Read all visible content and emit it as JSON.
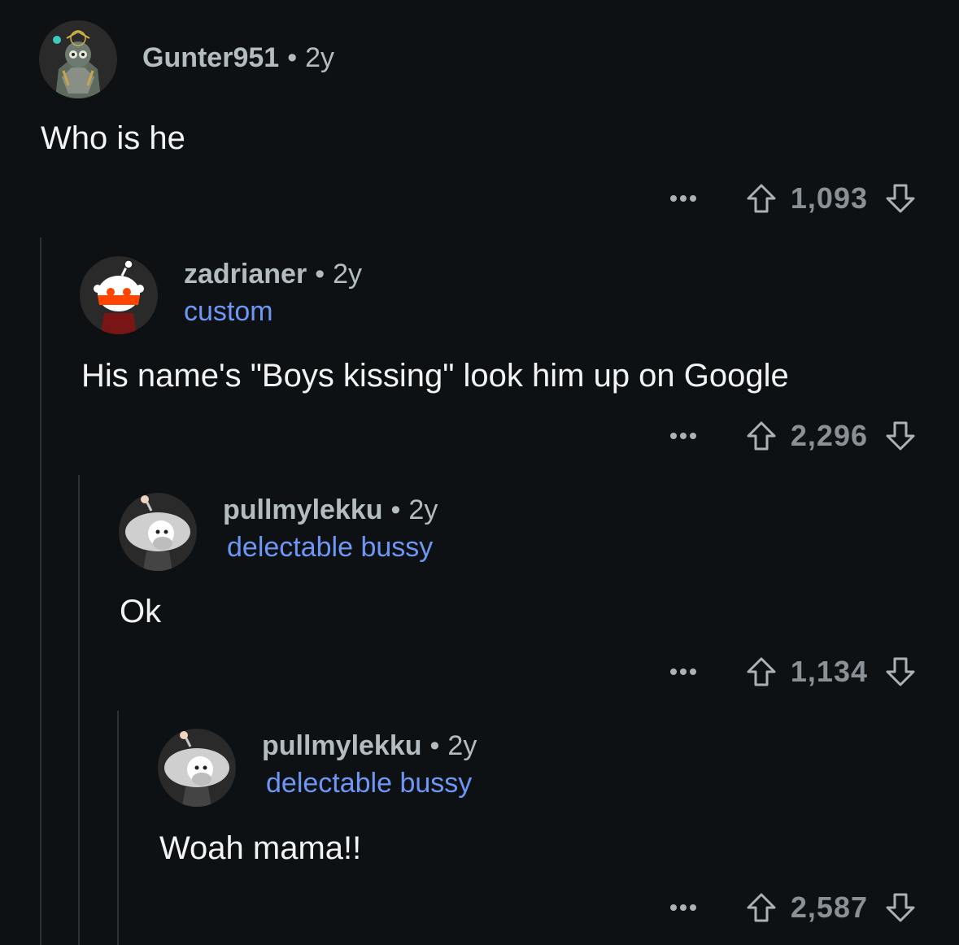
{
  "comments": [
    {
      "username": "Gunter951",
      "age": "2y",
      "flair": "",
      "body": "Who is he",
      "score": "1,093",
      "avatar": "armored-character-avatar"
    },
    {
      "username": "zadrianer",
      "age": "2y",
      "flair": "custom",
      "body": "His name's \"Boys kissing\" look him up on Google",
      "score": "2,296",
      "avatar": "snoo-red-visor-avatar"
    },
    {
      "username": "pullmylekku",
      "age": "2y",
      "flair": "delectable bussy",
      "body": "Ok",
      "score": "1,134",
      "avatar": "snoo-white-hair-avatar"
    },
    {
      "username": "pullmylekku",
      "age": "2y",
      "flair": "delectable bussy",
      "body": "Woah mama!!",
      "score": "2,587",
      "avatar": "snoo-white-hair-avatar"
    }
  ],
  "colors": {
    "background": "#0e1113",
    "username": "#b3bcc0",
    "flair": "#6e97f5",
    "body": "#f1f3f4",
    "meta": "#8a9196"
  },
  "icons": {
    "more": "more-options-icon",
    "upvote": "upvote-arrow-icon",
    "downvote": "downvote-arrow-icon"
  }
}
